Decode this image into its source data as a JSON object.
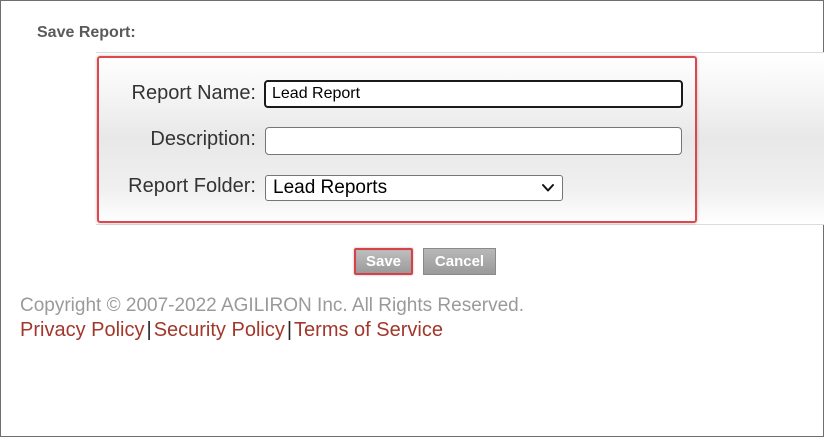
{
  "page": {
    "title": "Save Report:"
  },
  "form": {
    "report_name": {
      "label": "Report Name:",
      "value": "Lead Report"
    },
    "description": {
      "label": "Description:",
      "value": ""
    },
    "report_folder": {
      "label": "Report Folder:",
      "selected": "Lead Reports"
    }
  },
  "actions": {
    "save_label": "Save",
    "cancel_label": "Cancel"
  },
  "footer": {
    "copyright": "Copyright © 2007-2022 AGILIRON Inc. All Rights Reserved.",
    "links": [
      "Privacy Policy",
      "Security Policy",
      "Terms of Service"
    ],
    "separator": "|"
  },
  "colors": {
    "highlight": "#e0474c",
    "link": "#a2372b",
    "button": "#a8a8a8"
  }
}
